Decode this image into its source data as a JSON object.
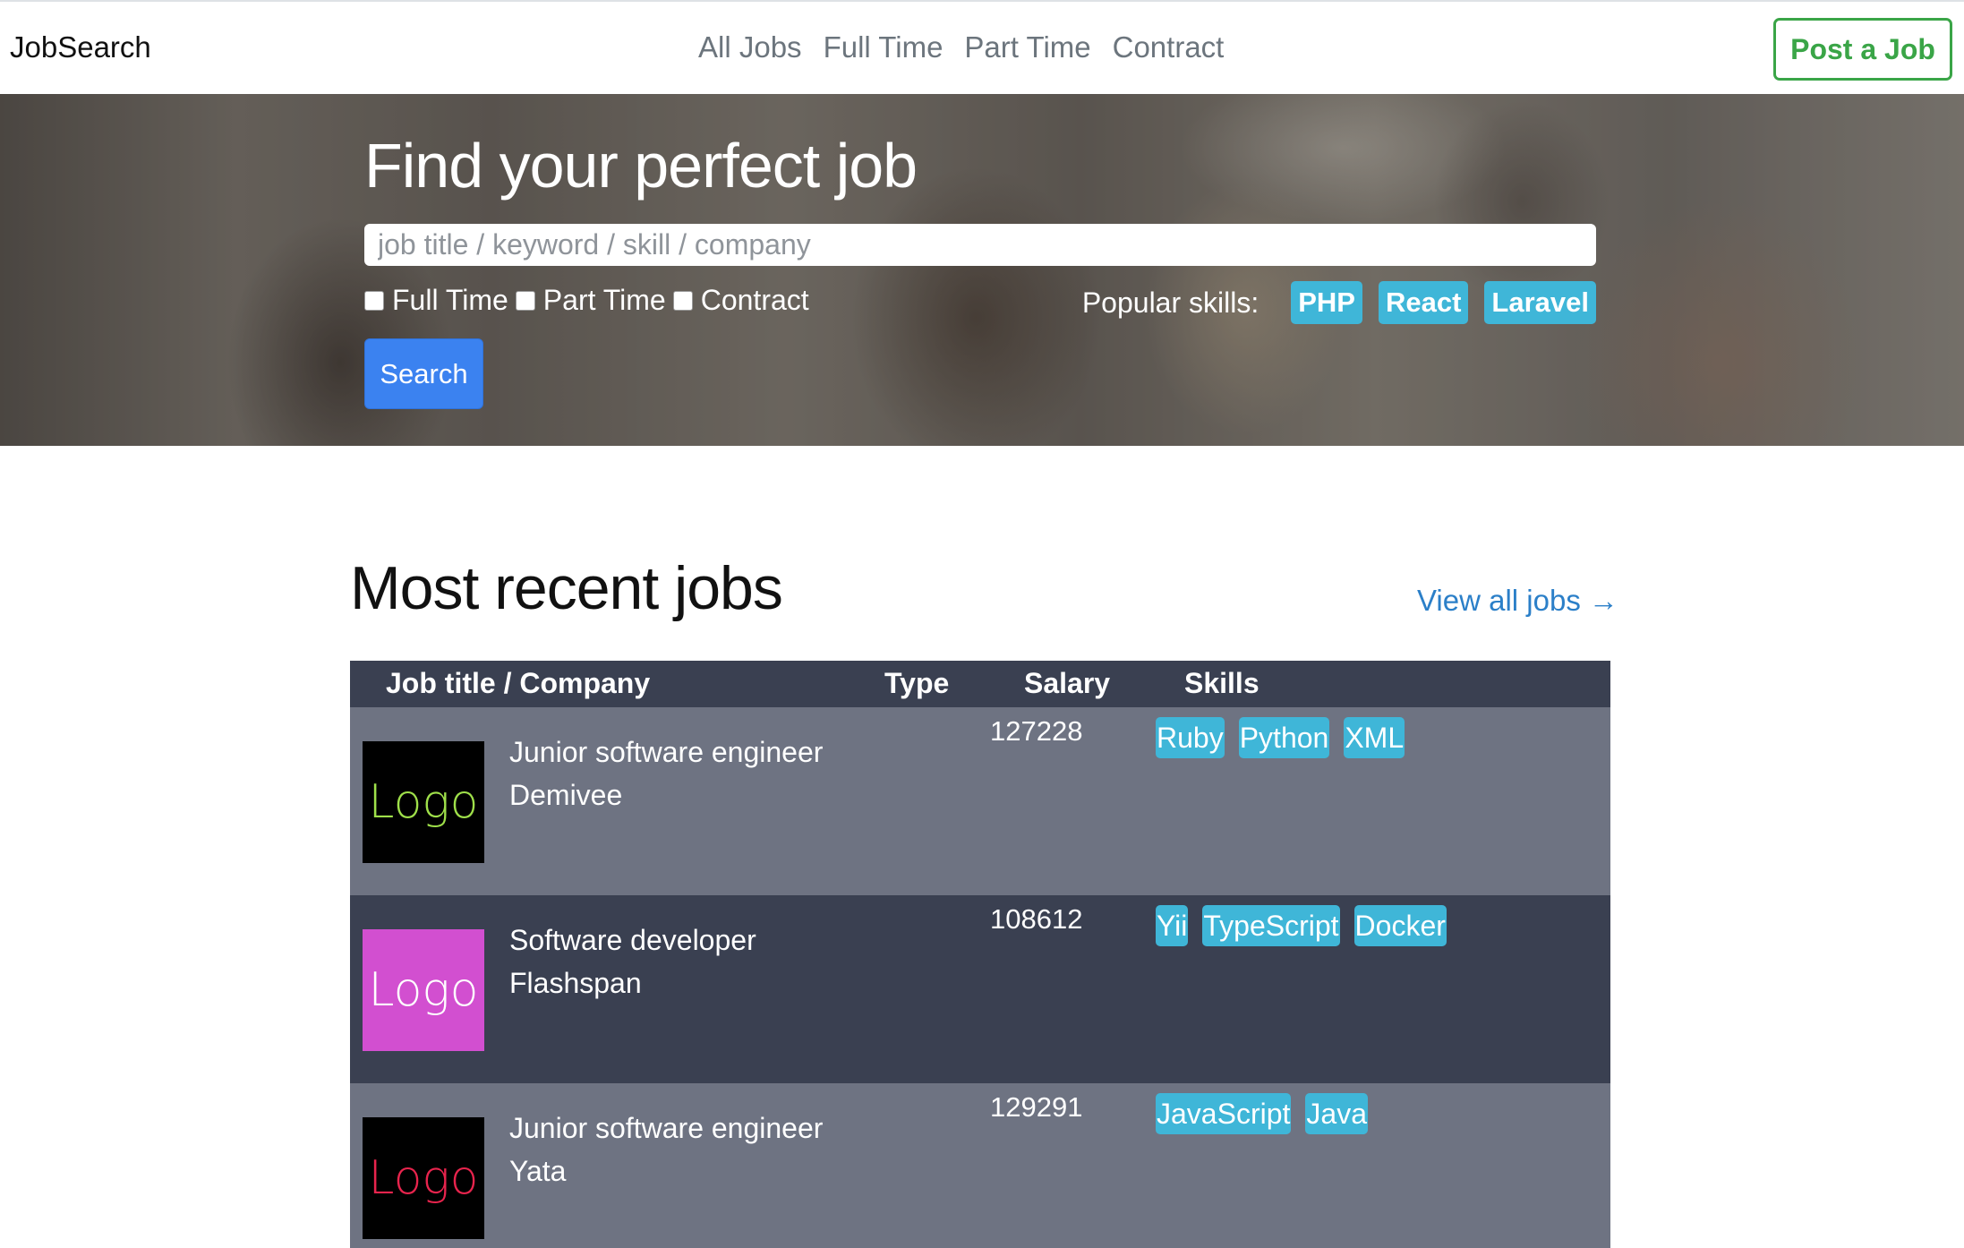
{
  "navbar": {
    "brand": "JobSearch",
    "links": [
      "All Jobs",
      "Full Time",
      "Part Time",
      "Contract"
    ],
    "post_button": "Post a Job",
    "post_button_color": "#3aa547"
  },
  "hero": {
    "title": "Find your perfect job",
    "search_placeholder": "job title / keyword / skill / company",
    "filters": [
      {
        "label": "Full Time",
        "checked": false
      },
      {
        "label": "Part Time",
        "checked": false
      },
      {
        "label": "Contract",
        "checked": false
      }
    ],
    "popular_label": "Popular skills:",
    "popular_skills": [
      "PHP",
      "React",
      "Laravel"
    ],
    "search_button": "Search",
    "accent": "#3b82f0",
    "badge_color": "#3fb6d8"
  },
  "recent": {
    "title": "Most recent jobs",
    "view_all": "View all jobs →",
    "columns": [
      "Job title / Company",
      "Type",
      "Salary",
      "Skills"
    ],
    "jobs": [
      {
        "logo_text": "Logo",
        "logo_bg": "#000000",
        "logo_color": "#9fe04a",
        "title": "Junior software engineer",
        "company": "Demivee",
        "type": "",
        "salary": "127228",
        "skills": [
          "Ruby",
          "Python",
          "XML"
        ]
      },
      {
        "logo_text": "Logo",
        "logo_bg": "#d24fd0",
        "logo_color": "#ffffff",
        "title": "Software developer",
        "company": "Flashspan",
        "type": "",
        "salary": "108612",
        "skills": [
          "Yii",
          "TypeScript",
          "Docker"
        ]
      },
      {
        "logo_text": "Logo",
        "logo_bg": "#000000",
        "logo_color": "#e8244d",
        "title": "Junior software engineer",
        "company": "Yata",
        "type": "",
        "salary": "129291",
        "skills": [
          "JavaScript",
          "Java"
        ]
      }
    ]
  }
}
